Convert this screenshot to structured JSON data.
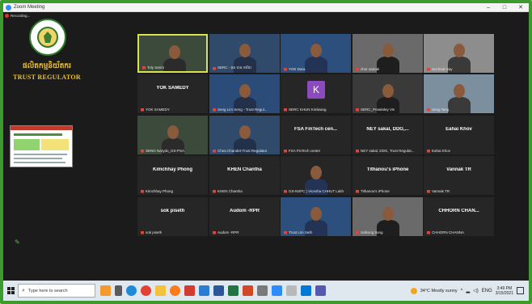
{
  "window": {
    "title": "Zoom Meeting",
    "minimize": "–",
    "maximize": "□",
    "close": "✕"
  },
  "recording": "Recording...",
  "logo": {
    "khmer": "ផលិតកម្មនិយ័តករ",
    "english": "TRUST REGULATOR"
  },
  "tiles": [
    {
      "name": "Toly Sarim",
      "video": true,
      "active": true
    },
    {
      "name": "SERC - ឆន បាន ការិយ",
      "video": true
    },
    {
      "name": "YOK Dara",
      "video": true
    },
    {
      "name": "chor samak",
      "video": true
    },
    {
      "name": "Socheat Say",
      "video": true
    },
    {
      "name": "YOK SAMEDY",
      "label": "YOK SAMEDY",
      "video": false
    },
    {
      "name": "Seng Lim Seng - Trust Regul...",
      "video": true
    },
    {
      "name": "SERC KHUN Kimleang",
      "avatar": "K",
      "video": false
    },
    {
      "name": "SERC_Preaksley Vin",
      "video": true
    },
    {
      "name": "Seng Tang",
      "video": true
    },
    {
      "name": "SENG Narydo_GS-PSA",
      "video": true
    },
    {
      "name": "Chea Chandet-Trust Regulator",
      "video": true
    },
    {
      "name": "FSA FinTech center",
      "label": "FSA FinTech cen...",
      "video": false
    },
    {
      "name": "NEY sakal, DDG, Trust Regulat...",
      "label": "NEY sakal, DDG,...",
      "video": false
    },
    {
      "name": "Eahai Khov",
      "label": "Eahai Khov",
      "video": false
    },
    {
      "name": "Kimchhay Phong",
      "label": "Kimchhay Phong",
      "video": false
    },
    {
      "name": "KHEN Chantha",
      "label": "KHEN Chantha",
      "video": false
    },
    {
      "name": "GS-NSPC | Vicesha CHHUT Lakh",
      "video": true
    },
    {
      "name": "Tithanou's iPhone",
      "label": "Tithanou's iPhone",
      "video": false
    },
    {
      "name": "Vannak TR",
      "label": "Vannak TR",
      "video": false
    },
    {
      "name": "sok piseth",
      "label": "sok piseth",
      "video": false
    },
    {
      "name": "Audom -RPR",
      "label": "Audom -RPR",
      "video": false
    },
    {
      "name": "Trust Lim Seth",
      "video": true
    },
    {
      "name": "Solkong bong",
      "video": true
    },
    {
      "name": "CHHORN CHANNA",
      "label": "CHHORN CHAN...",
      "video": false
    }
  ],
  "taskbar": {
    "search_placeholder": "Type here to search",
    "weather": "34°C  Mostly sunny",
    "lang": "ENG",
    "time": "3:49 PM",
    "date": "3/15/2021"
  }
}
